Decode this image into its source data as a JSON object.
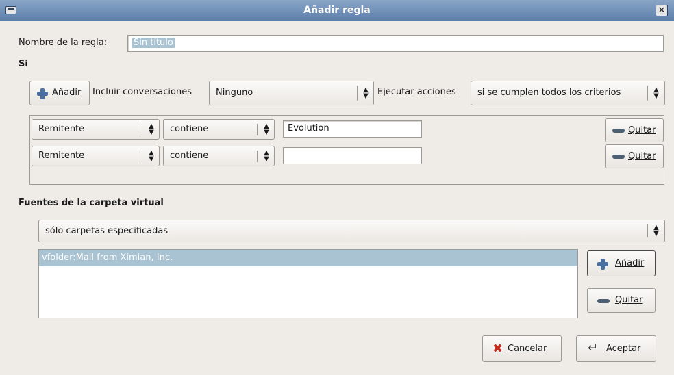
{
  "window": {
    "title": "Añadir regla"
  },
  "rule_name": {
    "label": "Nombre de la regla:",
    "value": "Sin título"
  },
  "if_section": {
    "heading": "Si"
  },
  "criteria_toolbar": {
    "add_button": "Añadir",
    "include_label": "Incluir conversaciones",
    "include_value": "Ninguno",
    "execute_label": "Ejecutar acciones",
    "execute_value": "si se cumplen todos los criterios"
  },
  "criteria": [
    {
      "field": "Remitente",
      "operator": "contiene",
      "value": "Evolution",
      "remove": "Quitar"
    },
    {
      "field": "Remitente",
      "operator": "contiene",
      "value": "",
      "remove": "Quitar"
    }
  ],
  "sources": {
    "heading": "Fuentes de la carpeta virtual",
    "mode": "sólo carpetas especificadas",
    "items": [
      "vfolder:Mail from Ximian, Inc."
    ],
    "add_button": "Añadir",
    "remove_button": "Quitar"
  },
  "footer": {
    "cancel": "Cancelar",
    "ok": "Aceptar"
  }
}
